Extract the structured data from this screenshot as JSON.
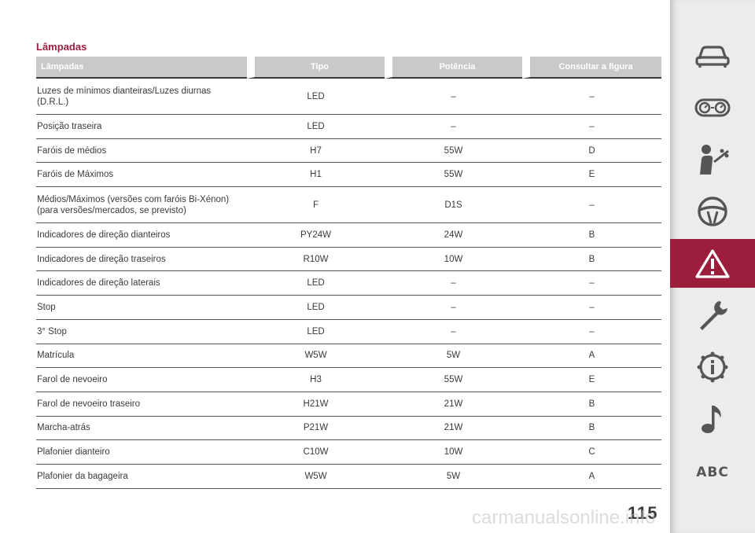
{
  "section_title": "Lâmpadas",
  "table": {
    "headers": [
      "Lâmpadas",
      "Tipo",
      "Potência",
      "Consultar a figura"
    ],
    "rows": [
      {
        "name_lines": [
          "Luzes de mínimos dianteiras/Luzes diurnas",
          "(D.R.L.)"
        ],
        "tipo": "LED",
        "potencia": "–",
        "figura": "–"
      },
      {
        "name_lines": [
          "Posição traseira"
        ],
        "tipo": "LED",
        "potencia": "–",
        "figura": "–"
      },
      {
        "name_lines": [
          "Faróis de médios"
        ],
        "tipo": "H7",
        "potencia": "55W",
        "figura": "D"
      },
      {
        "name_lines": [
          "Faróis de Máximos"
        ],
        "tipo": "H1",
        "potencia": "55W",
        "figura": "E"
      },
      {
        "name_lines": [
          "Médios/Máximos (versões com faróis Bi-Xénon)",
          "(para versões/mercados, se previsto)"
        ],
        "tipo": "F",
        "potencia": "D1S",
        "figura": "–"
      },
      {
        "name_lines": [
          "Indicadores de direção dianteiros"
        ],
        "tipo": "PY24W",
        "potencia": "24W",
        "figura": "B"
      },
      {
        "name_lines": [
          "Indicadores de direção traseiros"
        ],
        "tipo": "R10W",
        "potencia": "10W",
        "figura": "B"
      },
      {
        "name_lines": [
          "Indicadores de direção laterais"
        ],
        "tipo": "LED",
        "potencia": "–",
        "figura": "–"
      },
      {
        "name_lines": [
          "Stop"
        ],
        "tipo": "LED",
        "potencia": "–",
        "figura": "–"
      },
      {
        "name_lines": [
          "3° Stop"
        ],
        "tipo": "LED",
        "potencia": "–",
        "figura": "–"
      },
      {
        "name_lines": [
          "Matrícula"
        ],
        "tipo": "W5W",
        "potencia": "5W",
        "figura": "A"
      },
      {
        "name_lines": [
          "Farol de nevoeiro"
        ],
        "tipo": "H3",
        "potencia": "55W",
        "figura": "E"
      },
      {
        "name_lines": [
          "Farol de nevoeiro traseiro"
        ],
        "tipo": "H21W",
        "potencia": "21W",
        "figura": "B"
      },
      {
        "name_lines": [
          "Marcha-atrás"
        ],
        "tipo": "P21W",
        "potencia": "21W",
        "figura": "B"
      },
      {
        "name_lines": [
          "Plafonier dianteiro"
        ],
        "tipo": "C10W",
        "potencia": "10W",
        "figura": "C"
      },
      {
        "name_lines": [
          "Plafonier da bagageira"
        ],
        "tipo": "W5W",
        "potencia": "5W",
        "figura": "A"
      }
    ]
  },
  "page_number": "115",
  "watermark": "carmanualsonline.info",
  "sidebar": {
    "items": [
      {
        "icon": "car-icon",
        "active": false
      },
      {
        "icon": "dashboard-gauges-icon",
        "active": false
      },
      {
        "icon": "seatbelt-passenger-icon",
        "active": false
      },
      {
        "icon": "steering-wheel-icon",
        "active": false
      },
      {
        "icon": "warning-triangle-icon",
        "active": true
      },
      {
        "icon": "wrench-icon",
        "active": false
      },
      {
        "icon": "info-gear-icon",
        "active": false
      },
      {
        "icon": "music-note-icon",
        "active": false
      },
      {
        "icon": "abc-index-icon",
        "label": "ABC",
        "active": false
      }
    ],
    "colors": {
      "active_bg": "#9c1e3c",
      "icon": "#555555",
      "icon_active": "#ffffff"
    }
  },
  "colors": {
    "accent": "#9c1e3c",
    "header_bg": "#c9c9c9",
    "text": "#3a3a3a"
  }
}
